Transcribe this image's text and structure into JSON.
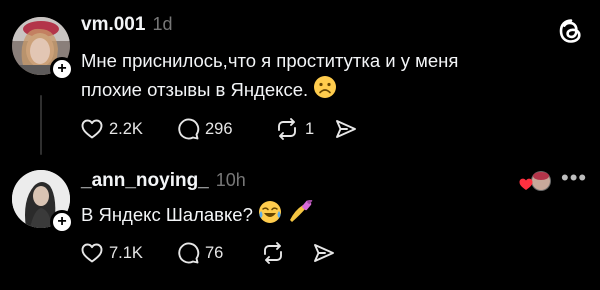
{
  "app": {
    "name": "Threads",
    "icon": "threads-logo-icon"
  },
  "posts": [
    {
      "username": "vm.001",
      "time": "1d",
      "lines": [
        "Мне приснилось,что я проститутка и у меня",
        "плохие отзывы в Яндексе."
      ],
      "emoji": "frowning-face",
      "likes": "2.2K",
      "comments": "296",
      "reposts": "1",
      "follow_icon": "plus-icon"
    },
    {
      "username": "_ann_noying_",
      "time": "10h",
      "text": "В Яндекс Шалавке?",
      "emojis": [
        "tears-of-joy-face",
        "nail-polish"
      ],
      "likes": "7.1K",
      "comments": "76",
      "follow_icon": "plus-icon",
      "liked_by_author": true
    }
  ],
  "colors": {
    "background": "#000000",
    "text": "#f3f5f7",
    "muted": "#777777",
    "heart": "#ff3040"
  }
}
